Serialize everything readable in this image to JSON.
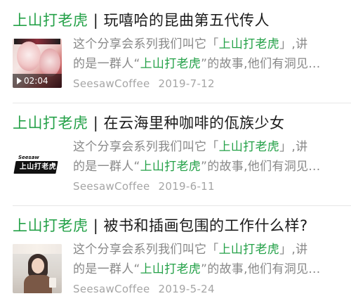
{
  "colors": {
    "accent": "#24a148",
    "title_text": "#1a1a1a",
    "excerpt_text": "#888888",
    "meta_text": "#a5a5a5"
  },
  "articles": [
    {
      "title_accent": "上山打老虎",
      "title_separator": "|",
      "title_text": "玩嘻哈的昆曲第五代传人",
      "thumbnail": "opera-performers-image",
      "video_duration": "02:04",
      "excerpt_line1_pre": "这个分享会系列我们叫它「",
      "excerpt_line1_em": "上山打老虎",
      "excerpt_line1_post": "」,讲",
      "excerpt_line2_pre": "的是一群人“",
      "excerpt_line2_em": "上山打老虎",
      "excerpt_line2_post": "”的故事,他们有洞见...",
      "source": "SeesawCoffee",
      "date": "2019-7-12"
    },
    {
      "title_accent": "上山打老虎",
      "title_separator": "|",
      "title_text": "在云海里种咖啡的佤族少女",
      "thumbnail": "seesaw-logo-card-image",
      "logo_small": "Seesaw",
      "logo_card": "上山打老虎",
      "excerpt_line1_pre": "这个分享会系列我们叫它「",
      "excerpt_line1_em": "上山打老虎",
      "excerpt_line1_post": "」,讲",
      "excerpt_line2_pre": "的是一群人“",
      "excerpt_line2_em": "上山打老虎",
      "excerpt_line2_post": "”的故事,他们有洞见...",
      "source": "SeesawCoffee",
      "date": "2019-6-11"
    },
    {
      "title_accent": "上山打老虎",
      "title_separator": "|",
      "title_text": "被书和插画包围的工作什么样?",
      "thumbnail": "woman-portrait-image",
      "excerpt_line1_pre": "这个分享会系列我们叫它「",
      "excerpt_line1_em": "上山打老虎",
      "excerpt_line1_post": "」,讲",
      "excerpt_line2_pre": "的是一群人“",
      "excerpt_line2_em": "上山打老虎",
      "excerpt_line2_post": "”的故事,他们有洞见...",
      "source": "SeesawCoffee",
      "date": "2019-5-24"
    }
  ]
}
